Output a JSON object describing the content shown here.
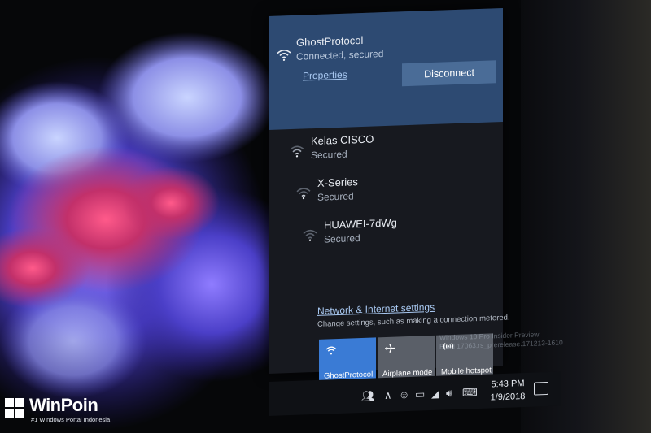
{
  "connected_network": {
    "name": "GhostProtocol",
    "status": "Connected, secured",
    "properties_label": "Properties",
    "disconnect_label": "Disconnect"
  },
  "networks": [
    {
      "name": "Kelas CISCO",
      "status": "Secured"
    },
    {
      "name": "X-Series",
      "status": "Secured"
    },
    {
      "name": "HUAWEI-7dWg",
      "status": "Secured"
    }
  ],
  "settings": {
    "link": "Network & Internet settings",
    "description": "Change settings, such as making a connection metered."
  },
  "quick_actions": [
    {
      "label": "GhostProtocol",
      "icon": "wifi-icon",
      "active": true
    },
    {
      "label": "Airplane mode",
      "icon": "airplane-icon",
      "active": false
    },
    {
      "label": "Mobile hotspot",
      "icon": "hotspot-icon",
      "active": false
    }
  ],
  "watermark": [
    "Windows 10 Pro Insider Preview",
    "Build 17063.rs_prerelease.171213-1610"
  ],
  "taskbar": {
    "time": "5:43 PM",
    "date": "1/9/2018"
  },
  "logo": {
    "name": "WinPoin",
    "tagline": "#1 Windows Portal Indonesia"
  },
  "colors": {
    "accent": "#3a7bd5",
    "connected_bg": "#2d4a72",
    "flyout_bg": "#17191f"
  }
}
